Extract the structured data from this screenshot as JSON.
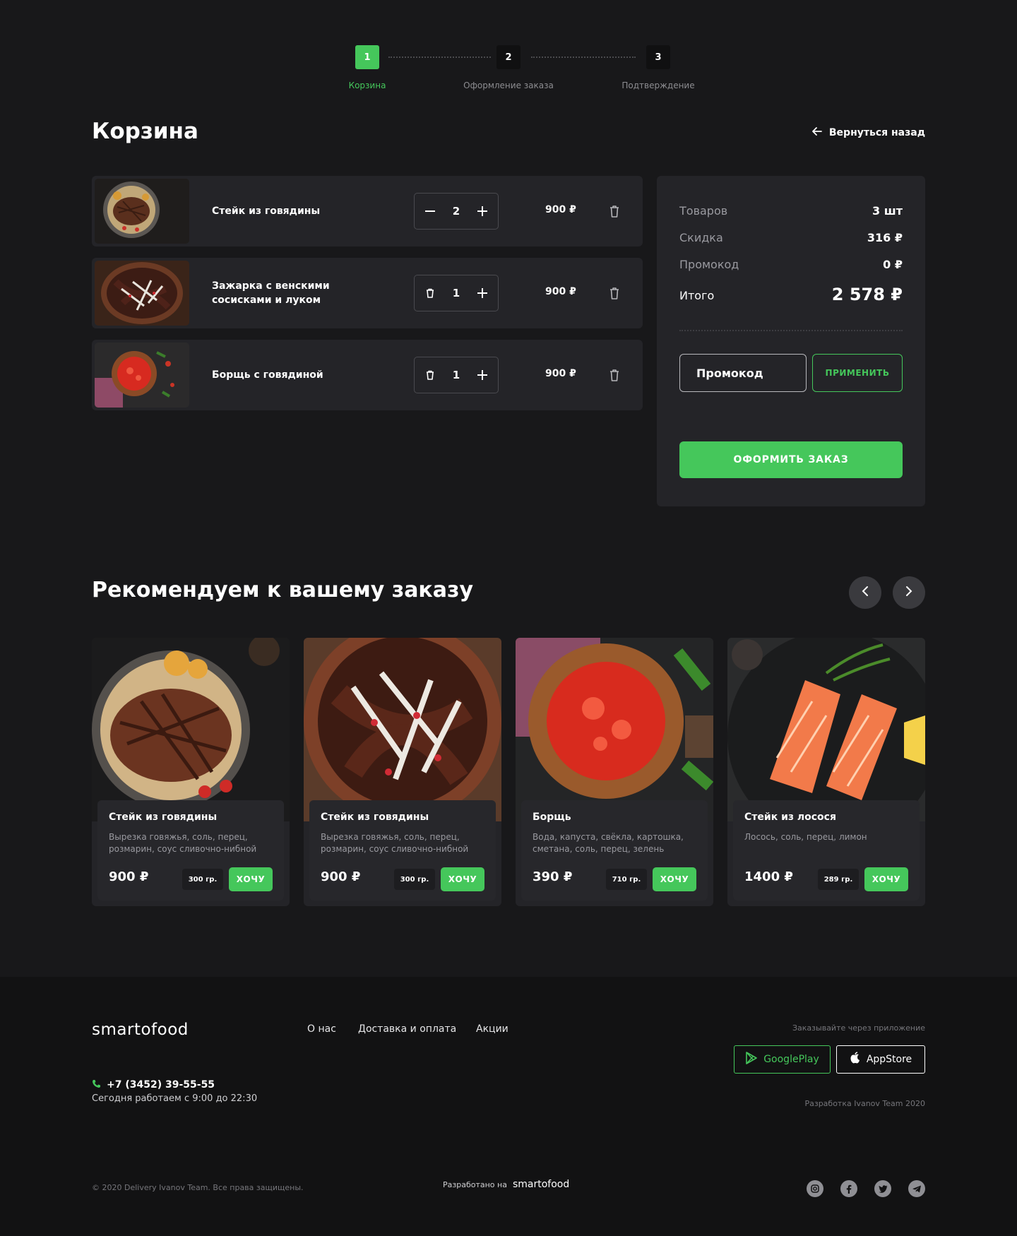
{
  "stepper": {
    "steps": [
      {
        "number": "1",
        "label": "Корзина"
      },
      {
        "number": "2",
        "label": "Оформление заказа"
      },
      {
        "number": "3",
        "label": "Подтверждение"
      }
    ],
    "active_step": 1
  },
  "page": {
    "title": "Корзина",
    "back_label": "Вернуться назад"
  },
  "cart": {
    "items": [
      {
        "name": "Стейк из говядины",
        "qty": "2",
        "price": "900 ₽"
      },
      {
        "name": "Зажарка с венскими сосисками и луком",
        "qty": "1",
        "price": "900 ₽"
      },
      {
        "name": "Борщь с говядиной",
        "qty": "1",
        "price": "900 ₽"
      }
    ]
  },
  "summary": {
    "items_label": "Товаров",
    "items_value": "3 шт",
    "discount_label": "Скидка",
    "discount_value": "316 ₽",
    "promo_label": "Промокод",
    "promo_value": "0 ₽",
    "total_label": "Итого",
    "total_value": "2 578 ₽",
    "promo_placeholder": "Промокод",
    "apply_label": "ПРИМЕНИТЬ",
    "order_label": "ОФОРМИТЬ ЗАКАЗ"
  },
  "recommend": {
    "title": "Рекомендуем к вашему заказу",
    "cards": [
      {
        "title": "Стейк из говядины",
        "desc": "Вырезка говяжья, соль, перец, розмарин, соус сливочно-нибной",
        "price": "900 ₽",
        "weight": "300 гр.",
        "button": "ХОЧУ"
      },
      {
        "title": "Стейк из говядины",
        "desc": "Вырезка говяжья, соль, перец, розмарин, соус сливочно-нибной",
        "price": "900 ₽",
        "weight": "300 гр.",
        "button": "ХОЧУ"
      },
      {
        "title": "Борщь",
        "desc": "Вода, капуста, свёкла, картошка, сметана, соль, перец, зелень",
        "price": "390 ₽",
        "weight": "710 гр.",
        "button": "ХОЧУ"
      },
      {
        "title": "Стейк из лосося",
        "desc": "Лосось, соль, перец, лимон",
        "price": "1400 ₽",
        "weight": "289 гр.",
        "button": "ХОЧУ"
      }
    ]
  },
  "footer": {
    "logo": "smartofood",
    "links": [
      "О нас",
      "Доставка и оплата",
      "Акции"
    ],
    "phone": "+7 (3452) 39-55-55",
    "hours": "Сегодня работаем с 9:00 до 22:30",
    "app_caption": "Заказывайте через приложение",
    "google_play": "GooglePlay",
    "app_store": "AppStore",
    "dev_credit": "Разработка Ivanov Team 2020",
    "copyright": "© 2020 Delivery Ivanov Team. Все права защищены.",
    "made_on": "Разработано на",
    "made_on_logo": "smartofood"
  },
  "colors": {
    "accent": "#45c75b",
    "background": "#18181a",
    "card": "#242428",
    "footer": "#121213"
  },
  "icons": [
    "arrow-left-icon",
    "minus-icon",
    "plus-icon",
    "trash-icon",
    "chevron-left-icon",
    "chevron-right-icon",
    "phone-icon",
    "google-play-icon",
    "apple-icon",
    "instagram-icon",
    "facebook-icon",
    "twitter-icon",
    "telegram-icon"
  ]
}
